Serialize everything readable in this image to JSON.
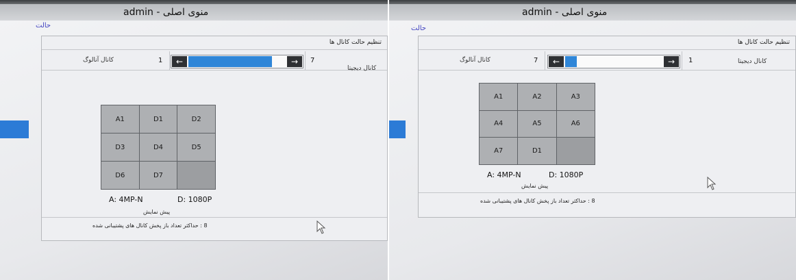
{
  "left": {
    "window_title": "منوی اصلی - admin",
    "mode_link": "حالت",
    "panel_title": "تنظیم حالت کانال ها",
    "analog_label": "کانال آنالوگ",
    "analog_value": "1",
    "digital_label": "کانال دیجیتا",
    "digital_value": "7",
    "slider_fraction": 0.85,
    "grid": [
      "A1",
      "D1",
      "D2",
      "D3",
      "D4",
      "D5",
      "D6",
      "D7",
      ""
    ],
    "res_analog": "A: 4MP-N",
    "res_digital": "D: 1080P",
    "preview_label": "پیش نمایش",
    "max_text": "8 : حداکثر تعداد باز پخش کانال های پشتیبانی شده"
  },
  "right": {
    "window_title": "منوی اصلی - admin",
    "mode_link": "حالت",
    "panel_title": "تنظیم حالت کانال ها",
    "analog_label": "کانال آنالوگ",
    "analog_value": "7",
    "digital_label": "کانال دیجیتا",
    "digital_value": "1",
    "slider_fraction": 0.12,
    "grid": [
      "A1",
      "A2",
      "A3",
      "A4",
      "A5",
      "A6",
      "A7",
      "D1",
      ""
    ],
    "res_analog": "A: 4MP-N",
    "res_digital": "D: 1080P",
    "preview_label": "پیش نمایش",
    "max_text": "8 : حداکثر تعداد باز پخش کانال های پشتیبانی شده"
  },
  "icons": {
    "left_arrow": "arrow-left-icon",
    "right_arrow": "arrow-right-icon",
    "cursor": "mouse-cursor-icon"
  }
}
